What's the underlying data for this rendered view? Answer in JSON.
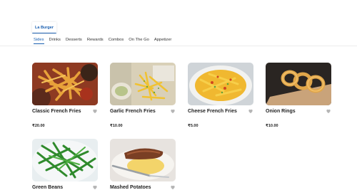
{
  "store": {
    "tab_label": "La Burger"
  },
  "categories": [
    "Sides",
    "Drinks",
    "Desserts",
    "Rewards",
    "Combos",
    "On The Go",
    "Appetizer"
  ],
  "active_category": "Sides",
  "items": [
    {
      "name": "Classic French Fries",
      "price": "₹20.00",
      "image": "classic-fries-image"
    },
    {
      "name": "Garlic French Fries",
      "price": "₹10.00",
      "image": "garlic-fries-image"
    },
    {
      "name": "Cheese French Fries",
      "price": "₹5.00",
      "image": "cheese-fries-image"
    },
    {
      "name": "Onion Rings",
      "price": "₹10.00",
      "image": "onion-rings-image"
    },
    {
      "name": "Green Beans",
      "price": "",
      "image": "green-beans-image"
    },
    {
      "name": "Mashed Potatoes",
      "price": "",
      "image": "mashed-potatoes-image"
    }
  ],
  "icons": {
    "favorite": "heart-icon"
  },
  "colors": {
    "accent": "#1a5fb0",
    "heart": "#b5b5b5"
  }
}
